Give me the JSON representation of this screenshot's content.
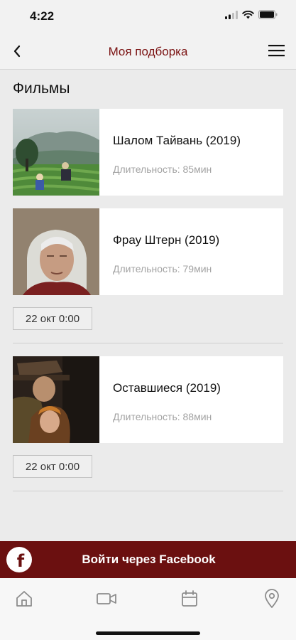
{
  "status": {
    "time": "4:22"
  },
  "nav": {
    "title": "Моя подборка",
    "back_icon": "chevron-left-icon",
    "menu_icon": "hamburger-icon"
  },
  "section": {
    "title": "Фильмы"
  },
  "duration_label": "Длительность:",
  "films": [
    {
      "title": "Шалом Тайвань (2019)",
      "duration": "85мин"
    },
    {
      "title": "Фрау Штерн (2019)",
      "duration": "79мин",
      "session": "22 окт 0:00"
    },
    {
      "title": "Оставшиеся (2019)",
      "duration": "88мин",
      "session": "22 окт 0:00"
    }
  ],
  "facebook": {
    "label": "Войти через Facebook",
    "icon": "facebook-icon"
  },
  "tabs": [
    {
      "icon": "home-icon"
    },
    {
      "icon": "video-camera-icon"
    },
    {
      "icon": "calendar-icon"
    },
    {
      "icon": "location-pin-icon"
    }
  ],
  "colors": {
    "accent": "#6b1010",
    "nav_title": "#7a1212",
    "background": "#ebebeb",
    "muted_text": "#a3a3a3"
  }
}
